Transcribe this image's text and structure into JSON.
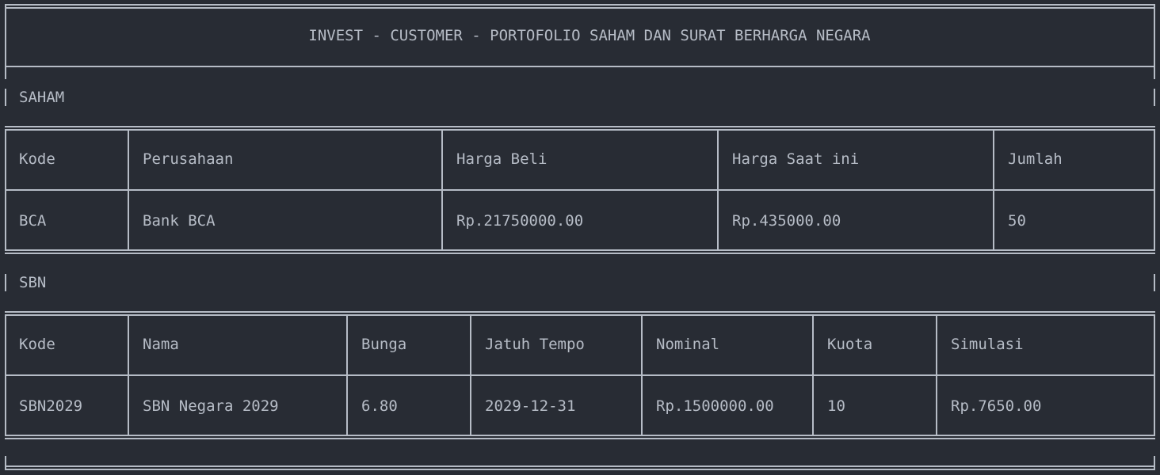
{
  "title": "INVEST - CUSTOMER - PORTOFOLIO SAHAM DAN SURAT BERHARGA NEGARA",
  "saham": {
    "section_label": "SAHAM",
    "headers": [
      "Kode",
      "Perusahaan",
      "Harga Beli",
      "Harga Saat ini",
      "Jumlah"
    ],
    "rows": [
      [
        "BCA",
        "Bank BCA",
        "Rp.21750000.00",
        "Rp.435000.00",
        "50"
      ]
    ]
  },
  "sbn": {
    "section_label": "SBN",
    "headers": [
      "Kode",
      "Nama",
      "Bunga",
      "Jatuh Tempo",
      "Nominal",
      "Kuota",
      "Simulasi"
    ],
    "rows": [
      [
        "SBN2029",
        "SBN Negara 2029",
        "6.80",
        "2029-12-31",
        "Rp.1500000.00",
        "10",
        "Rp.7650.00"
      ]
    ]
  }
}
